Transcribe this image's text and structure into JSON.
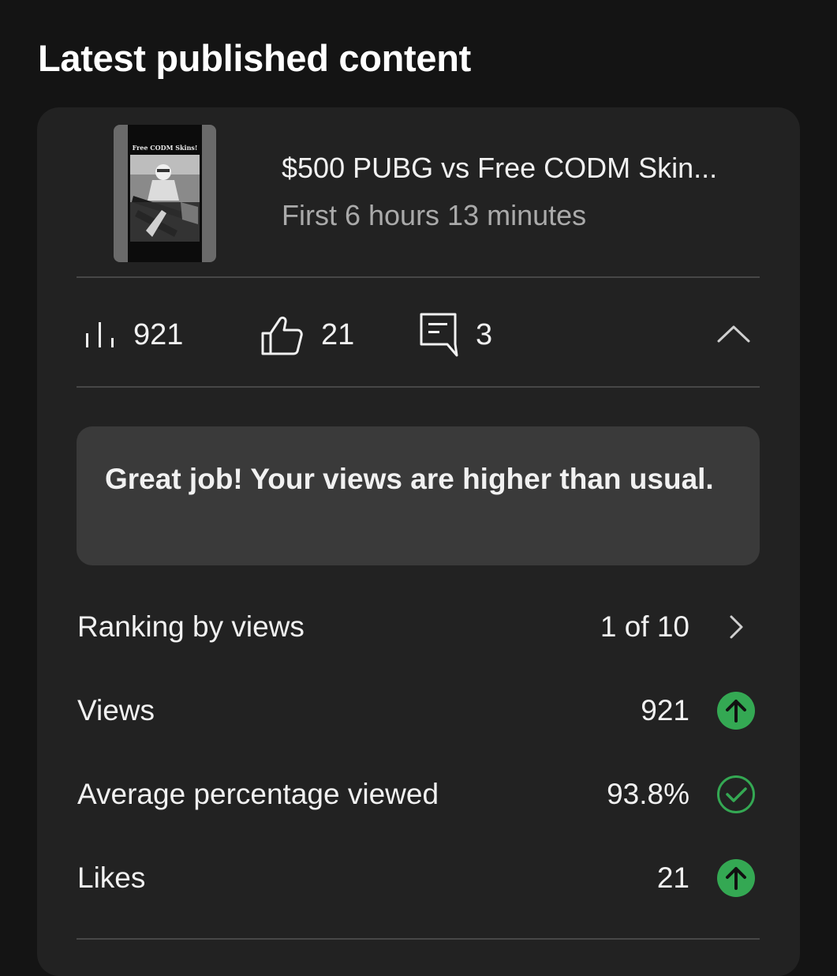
{
  "section": {
    "title": "Latest published content"
  },
  "video": {
    "thumbnail_caption": "Free CODM Skins!",
    "title": "$500 PUBG vs Free CODM Skin...",
    "period": "First 6 hours 13 minutes"
  },
  "stats": {
    "views": "921",
    "likes": "21",
    "comments": "3"
  },
  "notice": {
    "text": "Great job! Your views are higher than usual."
  },
  "metrics": [
    {
      "label": "Ranking by views",
      "value": "1 of 10",
      "indicator": "chevron-right-icon"
    },
    {
      "label": "Views",
      "value": "921",
      "indicator": "arrow-up-icon"
    },
    {
      "label": "Average percentage viewed",
      "value": "93.8%",
      "indicator": "check-circle-icon"
    },
    {
      "label": "Likes",
      "value": "21",
      "indicator": "arrow-up-icon"
    }
  ],
  "colors": {
    "background": "#141414",
    "card": "#222222",
    "notice": "#3a3a3a",
    "accent_green": "#34a853",
    "secondary_text": "#aaaaaa"
  }
}
